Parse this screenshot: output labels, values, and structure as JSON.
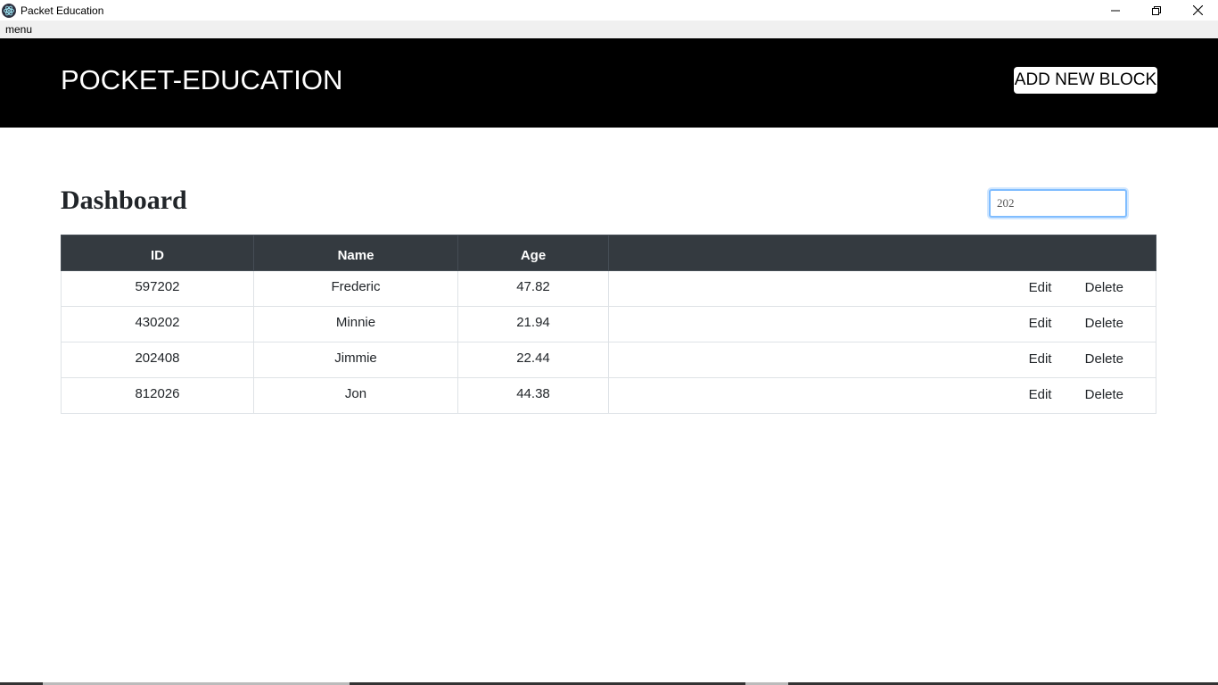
{
  "window": {
    "title": "Packet Education",
    "menu": [
      "menu"
    ]
  },
  "header": {
    "brand": "POCKET-EDUCATION",
    "add_button": "ADD NEW BLOCK"
  },
  "dashboard": {
    "title": "Dashboard",
    "search_value": "202"
  },
  "table": {
    "columns": [
      "ID",
      "Name",
      "Age",
      ""
    ],
    "rows": [
      {
        "id": "597202",
        "name": "Frederic",
        "age": "47.82",
        "edit": "Edit",
        "delete": "Delete"
      },
      {
        "id": "430202",
        "name": "Minnie",
        "age": "21.94",
        "edit": "Edit",
        "delete": "Delete"
      },
      {
        "id": "202408",
        "name": "Jimmie",
        "age": "22.44",
        "edit": "Edit",
        "delete": "Delete"
      },
      {
        "id": "812026",
        "name": "Jon",
        "age": "44.38",
        "edit": "Edit",
        "delete": "Delete"
      }
    ]
  },
  "colors": {
    "header_bg": "#000000",
    "table_head_bg": "#343a40",
    "focus_border": "#80bdff"
  }
}
